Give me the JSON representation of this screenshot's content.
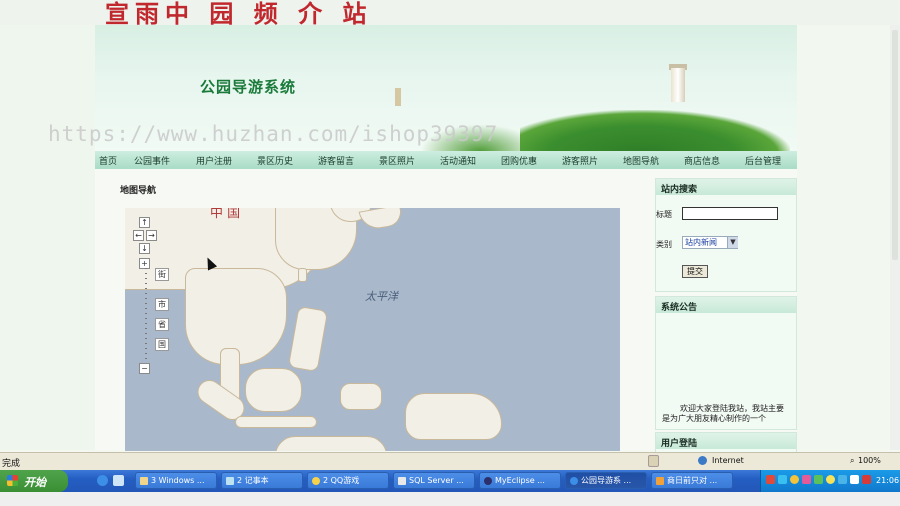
{
  "top_banner_text": "宣雨中 园 频 介 站",
  "site": {
    "title": "公园导游系统",
    "watermark": "https://www.huzhan.com/ishop39397"
  },
  "nav": {
    "items": [
      "首页",
      "公园事件",
      "用户注册",
      "景区历史",
      "游客留言",
      "景区照片",
      "活动通知",
      "团购优惠",
      "游客照片",
      "地图导航",
      "商店信息",
      "后台管理"
    ]
  },
  "content": {
    "title": "地图导航",
    "map": {
      "label_china": "中 国",
      "label_pacific": "太平洋",
      "zoom_plus": "+",
      "zoom_minus": "−",
      "zoom_levels": [
        "街",
        "市",
        "省",
        "国"
      ]
    }
  },
  "sidebar": {
    "search": {
      "title": "站内搜索",
      "title_label": "标题",
      "title_value": "",
      "category_label": "类别",
      "category_selected": "站内新闻",
      "submit_label": "提交"
    },
    "notice": {
      "title": "系统公告",
      "text": "欢迎大家登陆我站，我站主要是为广大朋友精心制作的一个"
    },
    "login": {
      "title": "用户登陆"
    }
  },
  "statusbar": {
    "status": "完成",
    "zone": "Internet",
    "zoom": "100%"
  },
  "taskbar": {
    "start_label": "开始",
    "tasks": [
      "3 Windows ...",
      "2 记事本",
      "2 QQ游戏",
      "SQL Server ...",
      "MyEclipse ...",
      "公园导游系 ...",
      "商日前只对 ..."
    ],
    "active_task_index": 5,
    "clock": "21:06"
  },
  "colors": {
    "brand_green": "#1a7a3a",
    "nav_bg": "#a9dcc6",
    "taskbar_blue": "#245ec2",
    "start_green": "#3a8f35"
  }
}
